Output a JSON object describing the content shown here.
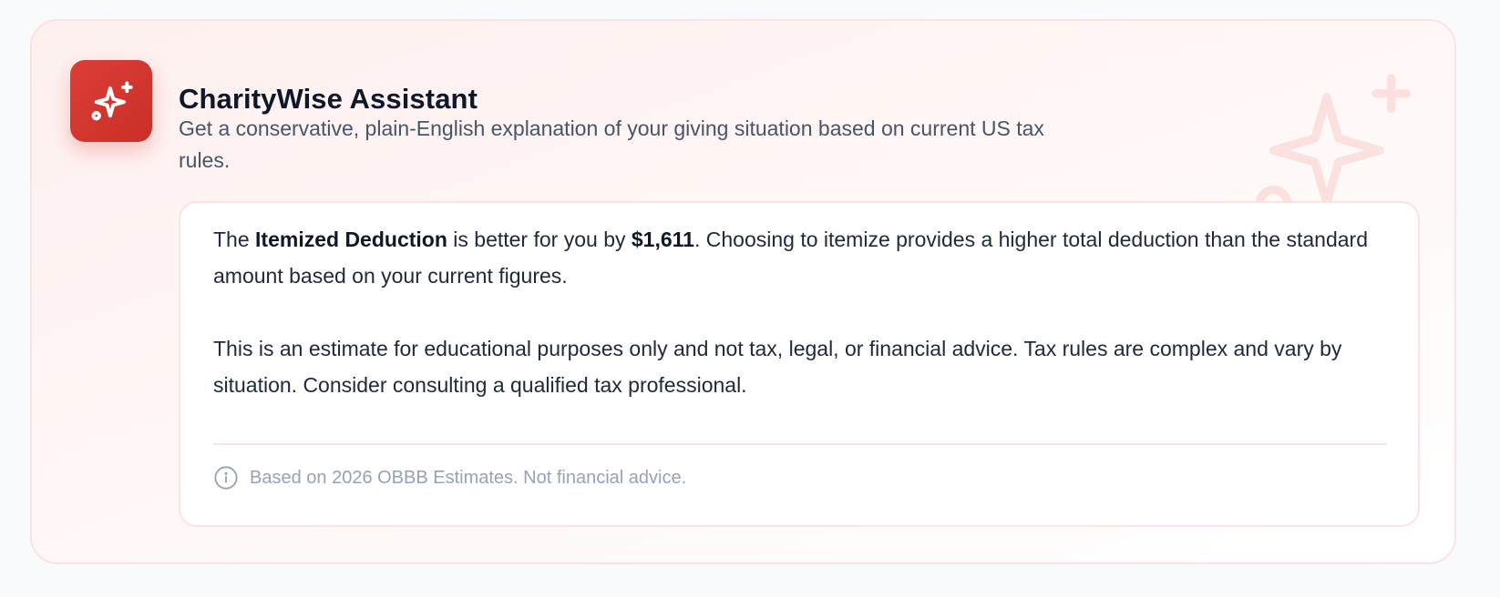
{
  "assistant": {
    "logo_icon": "sparkle-icon",
    "title": "CharityWise Assistant",
    "subtitle": "Get a conservative, plain-English explanation of your giving situation based on current US tax rules.",
    "accent_color": "#dc3e36"
  },
  "result": {
    "prefix": "The ",
    "option": "Itemized Deduction",
    "middle": " is better for you by ",
    "amount": "$1,611",
    "suffix": ". Choosing to itemize provides a higher total deduction than the standard amount based on your current figures.",
    "disclaimer": "This is an estimate for educational purposes only and not tax, legal, or financial advice. Tax rules are complex and vary by situation. Consider consulting a qualified tax professional."
  },
  "footer": {
    "icon": "info-icon",
    "note": "Based on 2026 OBBB Estimates. Not financial advice."
  }
}
